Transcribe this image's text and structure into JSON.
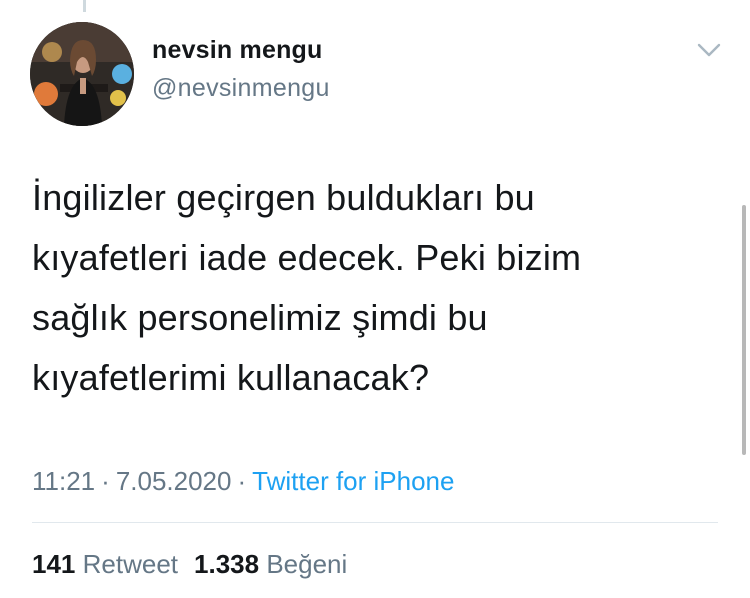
{
  "tweet": {
    "author_name": "nevsin mengu",
    "author_handle": "@nevsinmengu",
    "text_lines": [
      "İngilizler geçirgen buldukları bu",
      "kıyafetleri iade edecek. Peki bizim",
      "sağlık personelimiz şimdi bu",
      "kıyafetlerimi kullanacak?"
    ],
    "time": "11:21",
    "date": "7.05.2020",
    "separator": "·",
    "source": "Twitter for iPhone",
    "retweet_count": "141",
    "retweet_label": "Retweet",
    "like_count": "1.338",
    "like_label": "Beğeni"
  },
  "icons": {
    "menu": "chevron-down-icon",
    "avatar": "profile-photo"
  },
  "colors": {
    "text": "#14171a",
    "secondary": "#657786",
    "link": "#1da1f2",
    "divider": "#e1e8ed"
  }
}
